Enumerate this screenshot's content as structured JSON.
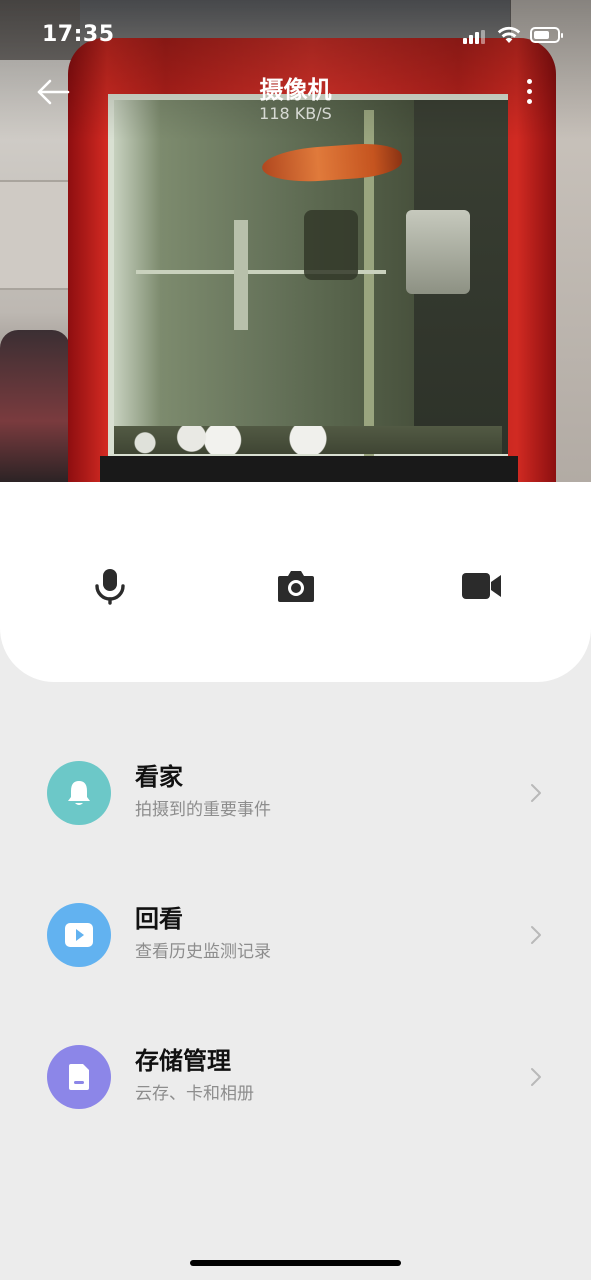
{
  "status_bar": {
    "time": "17:35",
    "signal_icon": "signal-bars-icon",
    "wifi_icon": "wifi-icon",
    "battery_icon": "battery-icon",
    "battery_level": 0.7
  },
  "header": {
    "title": "摄像机",
    "rate": "118 KB/S",
    "back_icon": "arrow-left-icon",
    "more_icon": "more-vertical-icon"
  },
  "controls": [
    {
      "name": "microphone",
      "icon": "microphone-icon"
    },
    {
      "name": "screenshot",
      "icon": "camera-icon"
    },
    {
      "name": "record",
      "icon": "video-icon"
    }
  ],
  "menu": [
    {
      "title": "看家",
      "subtitle": "拍摄到的重要事件",
      "icon": "bell-icon",
      "color": "#6cc8c8"
    },
    {
      "title": "回看",
      "subtitle": "查看历史监测记录",
      "icon": "play-icon",
      "color": "#62b2f0"
    },
    {
      "title": "存储管理",
      "subtitle": "云存、卡和相册",
      "icon": "sd-card-icon",
      "color": "#8c86e8"
    }
  ],
  "colors": {
    "background": "#ececec",
    "card": "#ffffff",
    "control_icon": "#2b2b2b",
    "chevron": "#b9b9b9"
  }
}
